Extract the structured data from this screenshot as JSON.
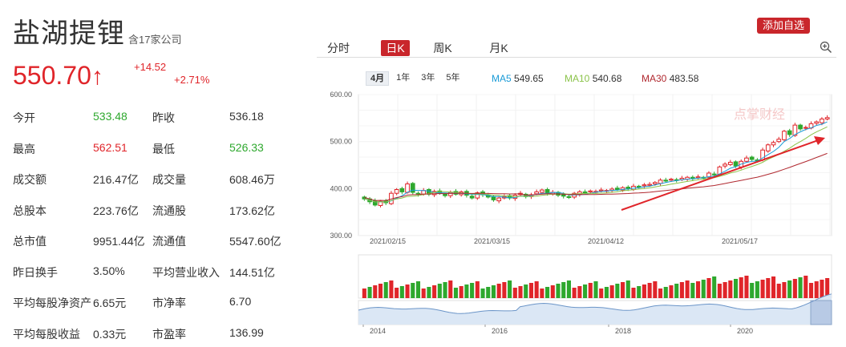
{
  "stock": {
    "name": "盐湖提锂",
    "subtitle": "含17家公司",
    "price": "550.70",
    "arrow": "↑",
    "change_abs": "+14.52",
    "change_pct": "+2.71%"
  },
  "stats": [
    {
      "l1": "今开",
      "v1": "533.48",
      "c1": "down",
      "l2": "昨收",
      "v2": "536.18",
      "c2": ""
    },
    {
      "l1": "最高",
      "v1": "562.51",
      "c1": "up",
      "l2": "最低",
      "v2": "526.33",
      "c2": "down"
    },
    {
      "l1": "成交额",
      "v1": "216.47亿",
      "c1": "",
      "l2": "成交量",
      "v2": "608.46万",
      "c2": ""
    },
    {
      "l1": "总股本",
      "v1": "223.76亿",
      "c1": "",
      "l2": "流通股",
      "v2": "173.62亿",
      "c2": ""
    },
    {
      "l1": "总市值",
      "v1": "9951.44亿",
      "c1": "",
      "l2": "流通值",
      "v2": "5547.60亿",
      "c2": ""
    },
    {
      "l1": "昨日换手",
      "v1": "3.50%",
      "c1": "",
      "l2": "平均营业收入",
      "v2": "144.51亿",
      "c2": ""
    },
    {
      "l1": "平均每股净资产",
      "v1": "6.65元",
      "c1": "",
      "l2": "市净率",
      "v2": "6.70",
      "c2": ""
    },
    {
      "l1": "平均每股收益",
      "v1": "0.33元",
      "c1": "",
      "l2": "市盈率",
      "v2": "136.99",
      "c2": ""
    }
  ],
  "toolbar": {
    "add_watchlist": "添加自选",
    "tabs": [
      "分时",
      "日K",
      "周K",
      "月K"
    ],
    "active_tab": "日K",
    "periods": [
      "4月",
      "1年",
      "3年",
      "5年"
    ],
    "active_period": "4月"
  },
  "ma": [
    {
      "label": "MA5",
      "value": "549.65",
      "color": "#1a9bd7"
    },
    {
      "label": "MA10",
      "value": "540.68",
      "color": "#8bc34a"
    },
    {
      "label": "MA30",
      "value": "483.58",
      "color": "#b0282f"
    }
  ],
  "colors": {
    "up": "#e0252a",
    "down": "#2ea82e",
    "accent": "#c9262b"
  },
  "watermark": "点掌财经",
  "chart_data": {
    "type": "candlestick",
    "y_ticks": [
      "600.00",
      "500.00",
      "400.00",
      "300.00"
    ],
    "ylim": [
      300,
      600
    ],
    "x_labels": [
      "2021/02/15",
      "2021/03/15",
      "2021/04/12",
      "2021/05/17"
    ],
    "closes": [
      378,
      372,
      365,
      373,
      370,
      390,
      398,
      393,
      410,
      392,
      388,
      396,
      388,
      394,
      390,
      385,
      392,
      388,
      393,
      386,
      380,
      391,
      387,
      382,
      376,
      380,
      383,
      380,
      386,
      390,
      383,
      387,
      393,
      397,
      390,
      392,
      386,
      384,
      381,
      390,
      393,
      391,
      395,
      394,
      397,
      396,
      399,
      398,
      402,
      400,
      405,
      404,
      408,
      409,
      413,
      418,
      416,
      420,
      418,
      422,
      424,
      421,
      425,
      423,
      433,
      430,
      446,
      452,
      456,
      448,
      458,
      465,
      462,
      460,
      482,
      493,
      498,
      505,
      522,
      515,
      535,
      527,
      530,
      538,
      542,
      548,
      551
    ],
    "volume_up": [
      1,
      0,
      1,
      1,
      0,
      1,
      1,
      0,
      1,
      0,
      0,
      1,
      0,
      1,
      0,
      0,
      1,
      0,
      1,
      0,
      0,
      1,
      0,
      0,
      0,
      1,
      1,
      0,
      1,
      1,
      0,
      1,
      1,
      1,
      0,
      1,
      0,
      0,
      0,
      1,
      1,
      0,
      1,
      0,
      1,
      0,
      1,
      0,
      1,
      0,
      1,
      0,
      1,
      1,
      1,
      1,
      0,
      1,
      0,
      1,
      1,
      0,
      1,
      0,
      1,
      0,
      1,
      1,
      1,
      0,
      1,
      1,
      0,
      0,
      1,
      1,
      1,
      1,
      1,
      0,
      1,
      0,
      1,
      1,
      1,
      1,
      1
    ],
    "overview_x_labels": [
      "2014",
      "2016",
      "2018",
      "2020"
    ]
  }
}
